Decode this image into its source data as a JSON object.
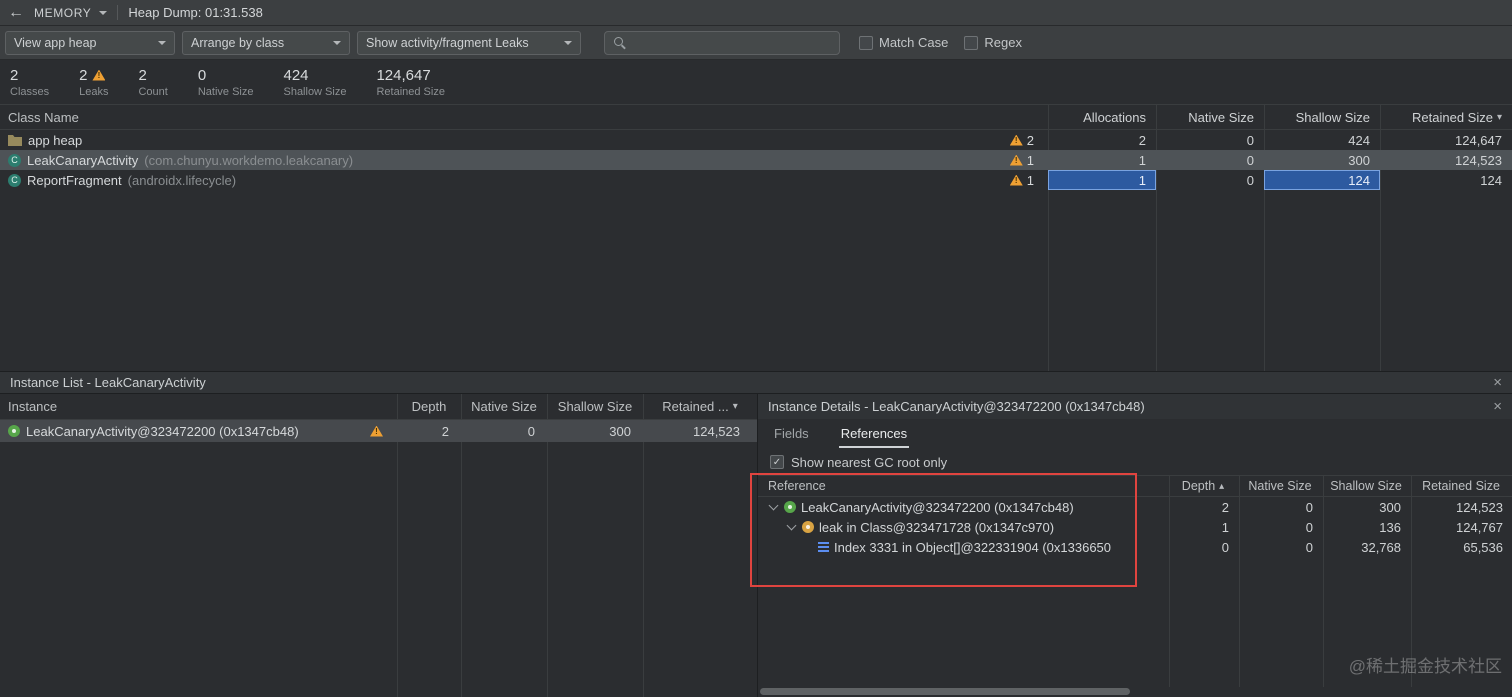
{
  "topbar": {
    "back_icon": "←",
    "memory_label": "MEMORY",
    "heap_dump_label": "Heap Dump: 01:31.538"
  },
  "toolbar": {
    "heap_combo": "View app heap",
    "arrange_combo": "Arrange by class",
    "leaks_combo": "Show activity/fragment Leaks",
    "search_value": "",
    "match_case_label": "Match Case",
    "regex_label": "Regex"
  },
  "stats": {
    "classes": {
      "value": "2",
      "label": "Classes"
    },
    "leaks": {
      "value": "2",
      "label": "Leaks"
    },
    "count": {
      "value": "2",
      "label": "Count"
    },
    "native": {
      "value": "0",
      "label": "Native Size"
    },
    "shallow": {
      "value": "424",
      "label": "Shallow Size"
    },
    "retained": {
      "value": "124,647",
      "label": "Retained Size"
    }
  },
  "class_table": {
    "columns": [
      "Class Name",
      "Allocations",
      "Native Size",
      "Shallow Size",
      "Retained Size"
    ],
    "rows": [
      {
        "name": "app heap",
        "package": "",
        "leak_count": "2",
        "allocations": "2",
        "native": "0",
        "shallow": "424",
        "retained": "124,647"
      },
      {
        "name": "LeakCanaryActivity",
        "package": "(com.chunyu.workdemo.leakcanary)",
        "leak_count": "1",
        "allocations": "1",
        "native": "0",
        "shallow": "300",
        "retained": "124,523"
      },
      {
        "name": "ReportFragment",
        "package": "(androidx.lifecycle)",
        "leak_count": "1",
        "allocations": "1",
        "native": "0",
        "shallow": "124",
        "retained": "124"
      }
    ]
  },
  "instance_list": {
    "title": "Instance List - LeakCanaryActivity",
    "close_icon": "×",
    "columns": [
      "Instance",
      "Depth",
      "Native Size",
      "Shallow Size",
      "Retained ..."
    ],
    "rows": [
      {
        "name": "LeakCanaryActivity@323472200 (0x1347cb48)",
        "depth": "2",
        "native": "0",
        "shallow": "300",
        "retained": "124,523"
      }
    ]
  },
  "instance_details": {
    "title": "Instance Details - LeakCanaryActivity@323472200 (0x1347cb48)",
    "close_icon": "×",
    "tabs": {
      "fields": "Fields",
      "references": "References"
    },
    "gc_root_label": "Show nearest GC root only",
    "columns": [
      "Reference",
      "Depth",
      "Native Size",
      "Shallow Size",
      "Retained Size"
    ],
    "rows": [
      {
        "label": "LeakCanaryActivity@323472200 (0x1347cb48)",
        "depth": "2",
        "native": "0",
        "shallow": "300",
        "retained": "124,523"
      },
      {
        "label": "leak in Class@323471728 (0x1347c970)",
        "depth": "1",
        "native": "0",
        "shallow": "136",
        "retained": "124,767"
      },
      {
        "label": "Index 3331 in Object[]@322331904 (0x1336650",
        "depth": "0",
        "native": "0",
        "shallow": "32,768",
        "retained": "65,536"
      }
    ]
  },
  "watermark": "@稀土掘金技术社区",
  "colors": {
    "warning": "#efa033",
    "selection_row": "#4e5357",
    "cell_highlight": "#2d5aa0",
    "annotation_box": "#e0443f"
  }
}
